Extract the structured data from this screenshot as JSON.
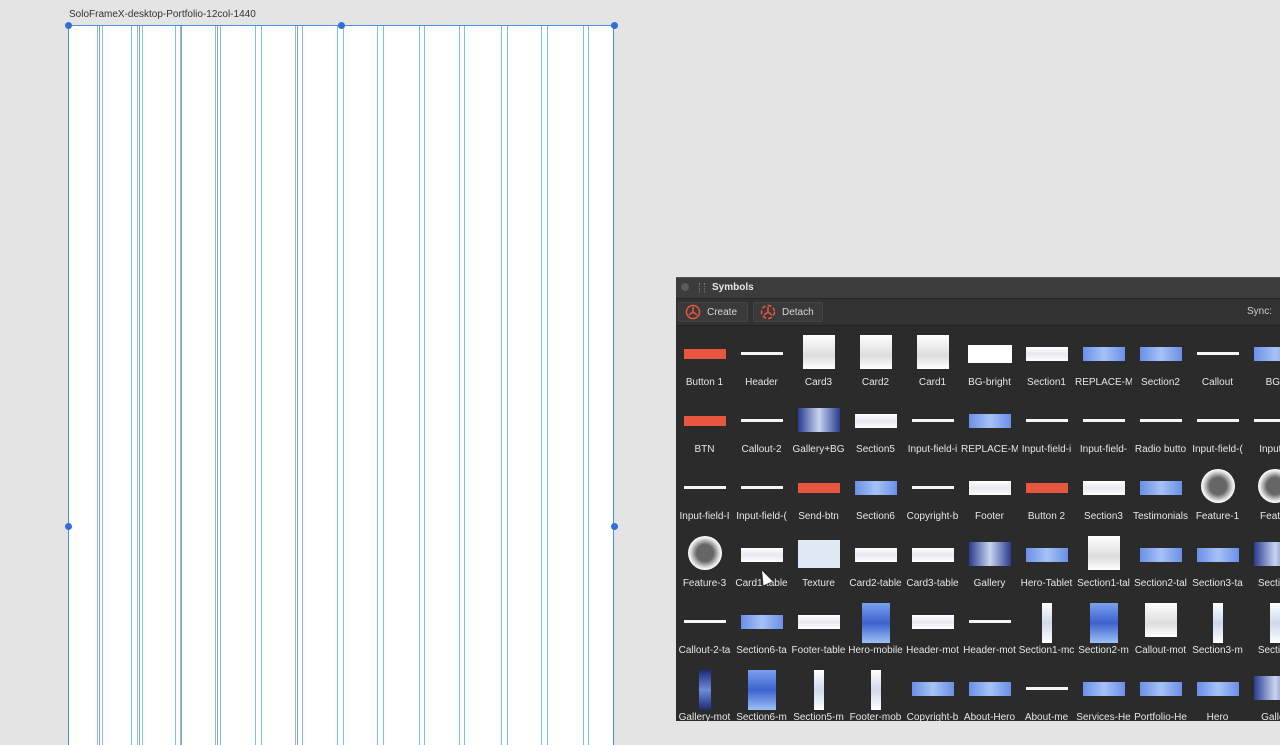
{
  "artboard": {
    "title": "SoloFrameX-desktop-Portfolio-12col-1440"
  },
  "panel": {
    "title": "Symbols",
    "create_label": "Create",
    "detach_label": "Detach",
    "sync_label": "Sync:"
  },
  "colors": {
    "accent": "#e8563f",
    "guide": "#7fc0ea",
    "selection": "#4a90e2",
    "panel_bg": "#2b2b2b"
  },
  "symbols": [
    {
      "label": "Button 1",
      "kind": "btn"
    },
    {
      "label": "Header",
      "kind": "line"
    },
    {
      "label": "Card3",
      "kind": "card"
    },
    {
      "label": "Card2",
      "kind": "card"
    },
    {
      "label": "Card1",
      "kind": "card"
    },
    {
      "label": "BG-bright",
      "kind": "white"
    },
    {
      "label": "Section1",
      "kind": "section"
    },
    {
      "label": "REPLACE-M",
      "kind": "blue"
    },
    {
      "label": "Section2",
      "kind": "blue"
    },
    {
      "label": "Callout",
      "kind": "line"
    },
    {
      "label": "BG-",
      "kind": "blue"
    },
    {
      "label": "BTN",
      "kind": "btn"
    },
    {
      "label": "Callout-2",
      "kind": "line"
    },
    {
      "label": "Gallery+BG",
      "kind": "dark"
    },
    {
      "label": "Section5",
      "kind": "section"
    },
    {
      "label": "Input-field-i",
      "kind": "line"
    },
    {
      "label": "REPLACE-M",
      "kind": "blue"
    },
    {
      "label": "Input-field-i",
      "kind": "line"
    },
    {
      "label": "Input-field-",
      "kind": "line"
    },
    {
      "label": "Radio butto",
      "kind": "line"
    },
    {
      "label": "Input-field-(",
      "kind": "line"
    },
    {
      "label": "Input-fi",
      "kind": "line"
    },
    {
      "label": "Input-field-I",
      "kind": "line"
    },
    {
      "label": "Input-field-(",
      "kind": "line"
    },
    {
      "label": "Send-btn",
      "kind": "btn"
    },
    {
      "label": "Section6",
      "kind": "blue"
    },
    {
      "label": "Copyright-b",
      "kind": "line"
    },
    {
      "label": "Footer",
      "kind": "section"
    },
    {
      "label": "Button 2",
      "kind": "btn"
    },
    {
      "label": "Section3",
      "kind": "section"
    },
    {
      "label": "Testimonials",
      "kind": "blue"
    },
    {
      "label": "Feature-1",
      "kind": "circle"
    },
    {
      "label": "Featur",
      "kind": "circle"
    },
    {
      "label": "Feature-3",
      "kind": "circle"
    },
    {
      "label": "Card1-table",
      "kind": "section"
    },
    {
      "label": "Texture",
      "kind": "texture"
    },
    {
      "label": "Card2-table",
      "kind": "section"
    },
    {
      "label": "Card3-table",
      "kind": "section"
    },
    {
      "label": "Gallery",
      "kind": "dark"
    },
    {
      "label": "Hero-Tablet",
      "kind": "blue"
    },
    {
      "label": "Section1-tal",
      "kind": "card"
    },
    {
      "label": "Section2-tal",
      "kind": "blue"
    },
    {
      "label": "Section3-ta",
      "kind": "blue"
    },
    {
      "label": "Section",
      "kind": "dark"
    },
    {
      "label": "Callout-2-ta",
      "kind": "line"
    },
    {
      "label": "Section6-ta",
      "kind": "blue"
    },
    {
      "label": "Footer-table",
      "kind": "section"
    },
    {
      "label": "Hero-mobile",
      "kind": "tallblue"
    },
    {
      "label": "Header-mot",
      "kind": "section"
    },
    {
      "label": "Header-mot",
      "kind": "line"
    },
    {
      "label": "Section1-mc",
      "kind": "tall"
    },
    {
      "label": "Section2-m",
      "kind": "tallblue"
    },
    {
      "label": "Callout-mot",
      "kind": "card"
    },
    {
      "label": "Section3-m",
      "kind": "tall"
    },
    {
      "label": "Section",
      "kind": "tall"
    },
    {
      "label": "Gallery-mot",
      "kind": "talldark"
    },
    {
      "label": "Section6-m",
      "kind": "tallblue"
    },
    {
      "label": "Section5-m",
      "kind": "tall"
    },
    {
      "label": "Footer-mob",
      "kind": "tall"
    },
    {
      "label": "Copyright-b",
      "kind": "blue"
    },
    {
      "label": "About-Hero",
      "kind": "blue"
    },
    {
      "label": "About-me",
      "kind": "line"
    },
    {
      "label": "Services-He",
      "kind": "blue"
    },
    {
      "label": "Portfolio-He",
      "kind": "blue"
    },
    {
      "label": "Hero",
      "kind": "blue"
    },
    {
      "label": "Galler",
      "kind": "dark"
    }
  ]
}
